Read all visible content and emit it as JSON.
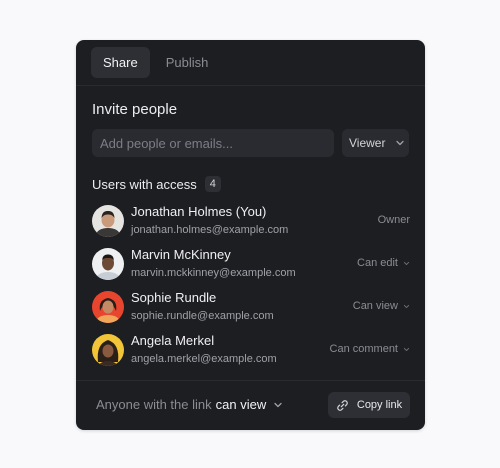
{
  "tabs": [
    {
      "label": "Share",
      "active": true
    },
    {
      "label": "Publish",
      "active": false
    }
  ],
  "invite": {
    "title": "Invite people",
    "placeholder": "Add people or emails...",
    "role": "Viewer",
    "role_icon": "chevron-down-icon"
  },
  "users": {
    "title": "Users with access",
    "count": "4",
    "list": [
      {
        "name": "Jonathan Holmes (You)",
        "email": "jonathan.holmes@example.com",
        "role": "Owner"
      },
      {
        "name": "Marvin McKinney",
        "email": "marvin.mckkinney@example.com",
        "role": "Can edit"
      },
      {
        "name": "Sophie Rundle",
        "email": "sophie.rundle@example.com",
        "role": "Can view"
      },
      {
        "name": "Angela Merkel",
        "email": "angela.merkel@example.com",
        "role": "Can comment"
      }
    ]
  },
  "footer": {
    "link_text": "Anyone with the link",
    "link_permission": "can view",
    "copy_label": "Copy link",
    "copy_icon": "link-icon"
  },
  "colors": {
    "background": "#f9f9fb",
    "panel": "#1d1e22",
    "control": "#2a2b30"
  }
}
